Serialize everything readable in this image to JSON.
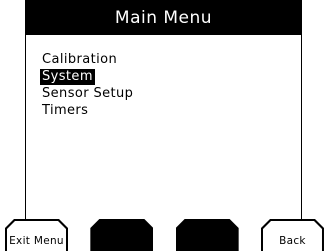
{
  "title": "Main Menu",
  "menu": {
    "items": [
      {
        "label": "Calibration",
        "selected": false
      },
      {
        "label": "System",
        "selected": true
      },
      {
        "label": "Sensor Setup",
        "selected": false
      },
      {
        "label": "Timers",
        "selected": false
      }
    ]
  },
  "softkeys": {
    "key1": "Exit Menu",
    "key2": "",
    "key3": "",
    "key4": "Back"
  },
  "colors": {
    "background": "#ffffff",
    "foreground": "#000000",
    "highlight_bg": "#000000",
    "highlight_fg": "#ffffff"
  }
}
